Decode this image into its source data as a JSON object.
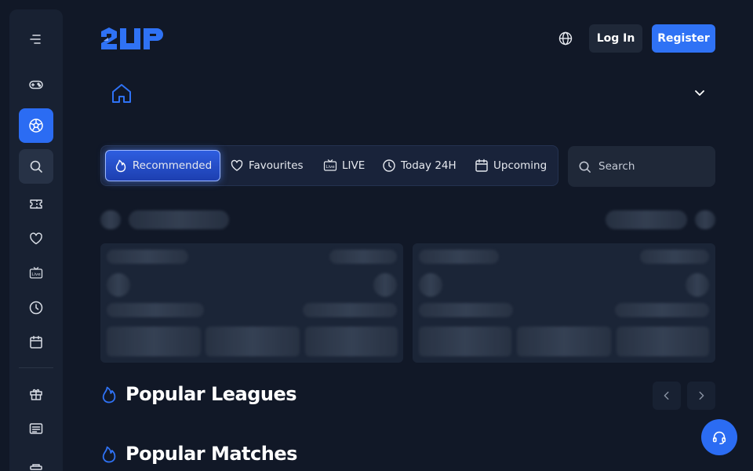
{
  "header": {
    "logo_text": "2UP",
    "login_label": "Log In",
    "register_label": "Register"
  },
  "tabs": [
    {
      "label": "Recommended",
      "icon": "flame-icon",
      "active": true
    },
    {
      "label": "Favourites",
      "icon": "heart-icon"
    },
    {
      "label": "LIVE",
      "icon": "live-tv-icon"
    },
    {
      "label": "Today 24H",
      "icon": "clock-icon"
    },
    {
      "label": "Upcoming",
      "icon": "calendar-icon"
    }
  ],
  "search": {
    "placeholder": "Search"
  },
  "sections": {
    "popular_leagues": "Popular Leagues",
    "popular_matches": "Popular Matches"
  },
  "sidebar": {
    "items": [
      "menu-icon",
      "gamepad-icon",
      "football-icon",
      "search-icon",
      "ticket-icon",
      "heart-icon",
      "live-icon",
      "clock-icon",
      "calendar-icon",
      "gift-icon",
      "news-icon",
      "more-icon"
    ]
  },
  "colors": {
    "accent": "#2f72f5",
    "background": "#111827",
    "sidebar": "#182132"
  }
}
